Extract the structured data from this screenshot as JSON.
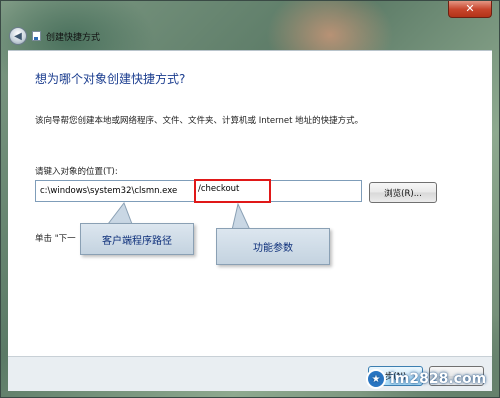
{
  "window": {
    "title": "创建快捷方式",
    "close_glyph": "✕",
    "back_glyph": "◀"
  },
  "dialog": {
    "heading": "想为哪个对象创建快捷方式?",
    "description": "该向导帮您创建本地或网络程序、文件、文件夹、计算机或 Internet 地址的快捷方式。",
    "location_label": "请键入对象的位置(T):",
    "location_value": "c:\\windows\\system32\\clsmn.exe",
    "browse_label": "浏览(R)...",
    "hint_text": "单击 \"下一"
  },
  "annotations": {
    "parameter_text": "/checkout",
    "callout_path": "客户端程序路径",
    "callout_param": "功能参数",
    "highlight_color": "#e01818"
  },
  "footer": {
    "next_label": "步(N)"
  },
  "watermark": {
    "text": "im2828.com",
    "logo_glyph": "★"
  }
}
